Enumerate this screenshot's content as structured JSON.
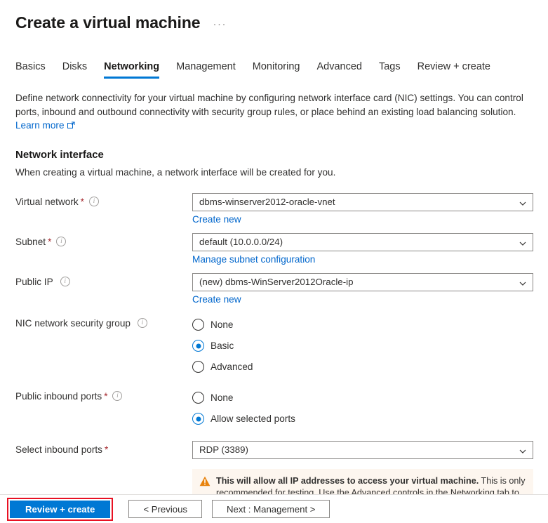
{
  "header": {
    "title": "Create a virtual machine",
    "more_menu": "···"
  },
  "tabs": [
    {
      "label": "Basics",
      "active": false
    },
    {
      "label": "Disks",
      "active": false
    },
    {
      "label": "Networking",
      "active": true
    },
    {
      "label": "Management",
      "active": false
    },
    {
      "label": "Monitoring",
      "active": false
    },
    {
      "label": "Advanced",
      "active": false
    },
    {
      "label": "Tags",
      "active": false
    },
    {
      "label": "Review + create",
      "active": false
    }
  ],
  "intro": {
    "paragraph": "Define network connectivity for your virtual machine by configuring network interface card (NIC) settings. You can control ports, inbound and outbound connectivity with security group rules, or place behind an existing load balancing solution.",
    "learn_more": "Learn more"
  },
  "section": {
    "title": "Network interface",
    "subtitle": "When creating a virtual machine, a network interface will be created for you."
  },
  "fields": {
    "virtual_network": {
      "label": "Virtual network",
      "required": "*",
      "value": "dbms-winserver2012-oracle-vnet",
      "sublink": "Create new"
    },
    "subnet": {
      "label": "Subnet",
      "required": "*",
      "value": "default (10.0.0.0/24)",
      "sublink": "Manage subnet configuration"
    },
    "public_ip": {
      "label": "Public IP",
      "required": "",
      "value": "(new) dbms-WinServer2012Oracle-ip",
      "sublink": "Create new"
    },
    "nic_nsg": {
      "label": "NIC network security group",
      "required": "",
      "options": [
        {
          "label": "None",
          "selected": false
        },
        {
          "label": "Basic",
          "selected": true
        },
        {
          "label": "Advanced",
          "selected": false
        }
      ]
    },
    "public_inbound_ports": {
      "label": "Public inbound ports",
      "required": "*",
      "options": [
        {
          "label": "None",
          "selected": false
        },
        {
          "label": "Allow selected ports",
          "selected": true
        }
      ]
    },
    "select_inbound_ports": {
      "label": "Select inbound ports",
      "required": "*",
      "value": "RDP (3389)"
    }
  },
  "warning": {
    "bold_text": "This will allow all IP addresses to access your virtual machine.",
    "rest_text": " This is only recommended for testing.  Use the Advanced controls in the Networking tab to create rules to limit inbound traffic to known IP addresses."
  },
  "footer": {
    "review_create": "Review + create",
    "previous": "< Previous",
    "next": "Next : Management >"
  },
  "colors": {
    "accent": "#0078d4",
    "link": "#0066cc",
    "required": "#a4262c",
    "warning_bg": "#fdf6ef",
    "warning_icon": "#e8820c",
    "highlight_border": "#e81123"
  }
}
